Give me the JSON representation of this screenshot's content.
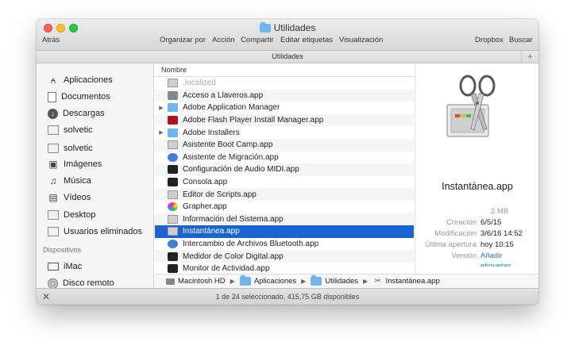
{
  "window": {
    "title": "Utilidades",
    "path_title": "Utilidades",
    "status": "1 de 24 seleccionado, 415,75 GB disponibles"
  },
  "toolbar": {
    "back": "Atrás",
    "arrange": "Organizar por",
    "action": "Acción",
    "share": "Compartir",
    "edit_tags": "Editar etiquetas",
    "view": "Visualización",
    "dropbox": "Dropbox",
    "search": "Buscar"
  },
  "sidebar": {
    "items": [
      {
        "label": "Aplicaciones",
        "icon": "applications-icon"
      },
      {
        "label": "Documentos",
        "icon": "document-icon"
      },
      {
        "label": "Descargas",
        "icon": "downloads-icon"
      },
      {
        "label": "solvetic",
        "icon": "folder-icon"
      },
      {
        "label": "solvetic",
        "icon": "folder-icon"
      },
      {
        "label": "Imágenes",
        "icon": "camera-icon"
      },
      {
        "label": "Música",
        "icon": "music-icon"
      },
      {
        "label": "Vídeos",
        "icon": "film-icon"
      },
      {
        "label": "Desktop",
        "icon": "folder-icon"
      },
      {
        "label": "Usuarios eliminados",
        "icon": "folder-icon"
      }
    ],
    "devices_header": "Dispositivos",
    "devices": [
      {
        "label": "iMac",
        "icon": "imac-icon"
      },
      {
        "label": "Disco remoto",
        "icon": "disc-icon"
      }
    ]
  },
  "filelist": {
    "column_name": "Nombre",
    "rows": [
      {
        "name": ".localized",
        "icon": "file-icon",
        "folder": false
      },
      {
        "name": "Acceso a Llaveros.app",
        "icon": "keychain-icon",
        "folder": false
      },
      {
        "name": "Adobe Application Manager",
        "icon": "folder-icon",
        "folder": true
      },
      {
        "name": "Adobe Flash Player Install Manager.app",
        "icon": "flash-icon",
        "folder": false
      },
      {
        "name": "Adobe Installers",
        "icon": "folder-icon",
        "folder": true
      },
      {
        "name": "Asistente Boot Camp.app",
        "icon": "bootcamp-icon",
        "folder": false
      },
      {
        "name": "Asistente de Migración.app",
        "icon": "migration-icon",
        "folder": false
      },
      {
        "name": "Configuración de Audio MIDI.app",
        "icon": "midi-icon",
        "folder": false
      },
      {
        "name": "Consola.app",
        "icon": "console-icon",
        "folder": false
      },
      {
        "name": "Editor de Scripts.app",
        "icon": "script-icon",
        "folder": false
      },
      {
        "name": "Grapher.app",
        "icon": "grapher-icon",
        "folder": false
      },
      {
        "name": "Información del Sistema.app",
        "icon": "system-info-icon",
        "folder": false
      },
      {
        "name": "Instantánea.app",
        "icon": "grab-icon",
        "folder": false
      },
      {
        "name": "Intercambio de Archivos Bluetooth.app",
        "icon": "bluetooth-icon",
        "folder": false
      },
      {
        "name": "Medidor de Color Digital.app",
        "icon": "color-meter-icon",
        "folder": false
      },
      {
        "name": "Monitor de Actividad.app",
        "icon": "activity-monitor-icon",
        "folder": false
      }
    ]
  },
  "preview": {
    "name": "Instantánea.app",
    "size": "2 MB",
    "fields": [
      {
        "key": "Creación",
        "value": "6/5/15"
      },
      {
        "key": "Modificación",
        "value": "3/6/16 14:52"
      },
      {
        "key": "Última apertura",
        "value": "hoy 10:15"
      },
      {
        "key": "Versión",
        "value": "Añadir"
      }
    ],
    "tags_link": "etiquetas..."
  },
  "pathbar": {
    "segments": [
      "Macintosh HD",
      "Aplicaciones",
      "Utilidades",
      "Instantánea.app"
    ]
  },
  "colors": {
    "selection": "#1b63d1",
    "folder": "#6fb6ef",
    "link": "#2a7ad8"
  }
}
